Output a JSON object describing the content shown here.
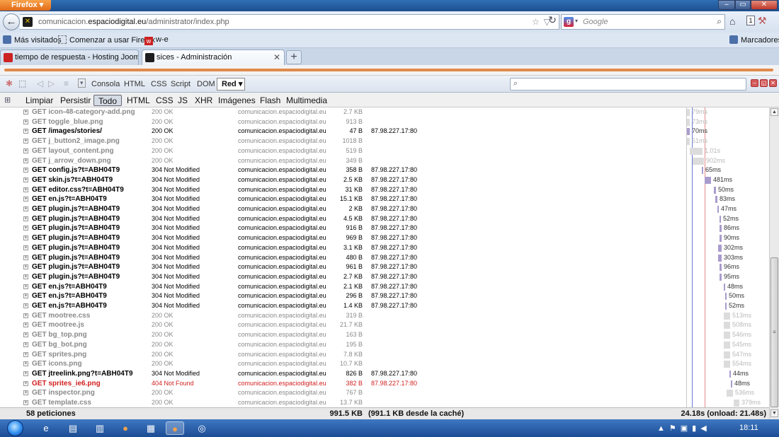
{
  "window": {
    "browser_button": "Firefox",
    "controls": {
      "minimize": "–",
      "maximize": "▭",
      "close": "✕"
    }
  },
  "nav": {
    "url_prefix": "comunicacion.",
    "url_domain": "espaciodigital.eu",
    "url_path": "/administrator/index.php",
    "search_placeholder": "Google"
  },
  "bookmarks": {
    "items": [
      "Más visitados",
      "Comenzar a usar Firefox",
      "w-e"
    ],
    "right": "Marcadores"
  },
  "tabs": [
    {
      "label": "tiempo de respuesta - Hosting Joomla",
      "active": false
    },
    {
      "label": "sices - Administración",
      "active": true
    }
  ],
  "firebug": {
    "panels": [
      "Consola",
      "HTML",
      "CSS",
      "Script",
      "DOM"
    ],
    "active_panel": "Red",
    "filters": [
      "Limpiar",
      "Persistir",
      "Todo",
      "HTML",
      "CSS",
      "JS",
      "XHR",
      "Imágenes",
      "Flash",
      "Multimedia"
    ],
    "active_filter": "Todo"
  },
  "requests": [
    {
      "url": "GET icon-48-category-add.png",
      "status": "200 OK",
      "domain": "comunicacion.espaciodigital.eu",
      "size": "2.7 KB",
      "ip": "",
      "time": "79ms",
      "kind": "cached"
    },
    {
      "url": "GET toggle_blue.png",
      "status": "200 OK",
      "domain": "comunicacion.espaciodigital.eu",
      "size": "913 B",
      "ip": "",
      "time": "73ms",
      "kind": "cached"
    },
    {
      "url": "GET /images/stories/",
      "status": "200 OK",
      "domain": "comunicacion.espaciodigital.eu",
      "size": "47 B",
      "ip": "87.98.227.17:80",
      "time": "70ms",
      "kind": "live"
    },
    {
      "url": "GET j_button2_image.png",
      "status": "200 OK",
      "domain": "comunicacion.espaciodigital.eu",
      "size": "1018 B",
      "ip": "",
      "time": "51ms",
      "kind": "cached"
    },
    {
      "url": "GET layout_content.png",
      "status": "200 OK",
      "domain": "comunicacion.espaciodigital.eu",
      "size": "519 B",
      "ip": "",
      "time": "1.01s",
      "kind": "cached"
    },
    {
      "url": "GET j_arrow_down.png",
      "status": "200 OK",
      "domain": "comunicacion.espaciodigital.eu",
      "size": "349 B",
      "ip": "",
      "time": "902ms",
      "kind": "cached"
    },
    {
      "url": "GET config.js?t=ABH04T9",
      "status": "304 Not Modified",
      "domain": "comunicacion.espaciodigital.eu",
      "size": "358 B",
      "ip": "87.98.227.17:80",
      "time": "65ms",
      "kind": "live"
    },
    {
      "url": "GET skin.js?t=ABH04T9",
      "status": "304 Not Modified",
      "domain": "comunicacion.espaciodigital.eu",
      "size": "2.5 KB",
      "ip": "87.98.227.17:80",
      "time": "481ms",
      "kind": "live"
    },
    {
      "url": "GET editor.css?t=ABH04T9",
      "status": "304 Not Modified",
      "domain": "comunicacion.espaciodigital.eu",
      "size": "31 KB",
      "ip": "87.98.227.17:80",
      "time": "50ms",
      "kind": "live"
    },
    {
      "url": "GET en.js?t=ABH04T9",
      "status": "304 Not Modified",
      "domain": "comunicacion.espaciodigital.eu",
      "size": "15.1 KB",
      "ip": "87.98.227.17:80",
      "time": "83ms",
      "kind": "live"
    },
    {
      "url": "GET plugin.js?t=ABH04T9",
      "status": "304 Not Modified",
      "domain": "comunicacion.espaciodigital.eu",
      "size": "2 KB",
      "ip": "87.98.227.17:80",
      "time": "47ms",
      "kind": "live"
    },
    {
      "url": "GET plugin.js?t=ABH04T9",
      "status": "304 Not Modified",
      "domain": "comunicacion.espaciodigital.eu",
      "size": "4.5 KB",
      "ip": "87.98.227.17:80",
      "time": "52ms",
      "kind": "live"
    },
    {
      "url": "GET plugin.js?t=ABH04T9",
      "status": "304 Not Modified",
      "domain": "comunicacion.espaciodigital.eu",
      "size": "916 B",
      "ip": "87.98.227.17:80",
      "time": "86ms",
      "kind": "live"
    },
    {
      "url": "GET plugin.js?t=ABH04T9",
      "status": "304 Not Modified",
      "domain": "comunicacion.espaciodigital.eu",
      "size": "969 B",
      "ip": "87.98.227.17:80",
      "time": "90ms",
      "kind": "live"
    },
    {
      "url": "GET plugin.js?t=ABH04T9",
      "status": "304 Not Modified",
      "domain": "comunicacion.espaciodigital.eu",
      "size": "3.1 KB",
      "ip": "87.98.227.17:80",
      "time": "302ms",
      "kind": "live"
    },
    {
      "url": "GET plugin.js?t=ABH04T9",
      "status": "304 Not Modified",
      "domain": "comunicacion.espaciodigital.eu",
      "size": "480 B",
      "ip": "87.98.227.17:80",
      "time": "303ms",
      "kind": "live"
    },
    {
      "url": "GET plugin.js?t=ABH04T9",
      "status": "304 Not Modified",
      "domain": "comunicacion.espaciodigital.eu",
      "size": "961 B",
      "ip": "87.98.227.17:80",
      "time": "96ms",
      "kind": "live"
    },
    {
      "url": "GET plugin.js?t=ABH04T9",
      "status": "304 Not Modified",
      "domain": "comunicacion.espaciodigital.eu",
      "size": "2.7 KB",
      "ip": "87.98.227.17:80",
      "time": "95ms",
      "kind": "live"
    },
    {
      "url": "GET en.js?t=ABH04T9",
      "status": "304 Not Modified",
      "domain": "comunicacion.espaciodigital.eu",
      "size": "2.1 KB",
      "ip": "87.98.227.17:80",
      "time": "48ms",
      "kind": "live"
    },
    {
      "url": "GET en.js?t=ABH04T9",
      "status": "304 Not Modified",
      "domain": "comunicacion.espaciodigital.eu",
      "size": "296 B",
      "ip": "87.98.227.17:80",
      "time": "50ms",
      "kind": "live"
    },
    {
      "url": "GET en.js?t=ABH04T9",
      "status": "304 Not Modified",
      "domain": "comunicacion.espaciodigital.eu",
      "size": "1.4 KB",
      "ip": "87.98.227.17:80",
      "time": "52ms",
      "kind": "live"
    },
    {
      "url": "GET mootree.css",
      "status": "200 OK",
      "domain": "comunicacion.espaciodigital.eu",
      "size": "319 B",
      "ip": "",
      "time": "513ms",
      "kind": "cached"
    },
    {
      "url": "GET mootree.js",
      "status": "200 OK",
      "domain": "comunicacion.espaciodigital.eu",
      "size": "21.7 KB",
      "ip": "",
      "time": "508ms",
      "kind": "cached"
    },
    {
      "url": "GET bg_top.png",
      "status": "200 OK",
      "domain": "comunicacion.espaciodigital.eu",
      "size": "163 B",
      "ip": "",
      "time": "546ms",
      "kind": "cached"
    },
    {
      "url": "GET bg_bot.png",
      "status": "200 OK",
      "domain": "comunicacion.espaciodigital.eu",
      "size": "195 B",
      "ip": "",
      "time": "545ms",
      "kind": "cached"
    },
    {
      "url": "GET sprites.png",
      "status": "200 OK",
      "domain": "comunicacion.espaciodigital.eu",
      "size": "7.8 KB",
      "ip": "",
      "time": "547ms",
      "kind": "cached"
    },
    {
      "url": "GET icons.png",
      "status": "200 OK",
      "domain": "comunicacion.espaciodigital.eu",
      "size": "10.7 KB",
      "ip": "",
      "time": "554ms",
      "kind": "cached"
    },
    {
      "url": "GET jtreelink.png?t=ABH04T9",
      "status": "304 Not Modified",
      "domain": "comunicacion.espaciodigital.eu",
      "size": "826 B",
      "ip": "87.98.227.17:80",
      "time": "44ms",
      "kind": "live"
    },
    {
      "url": "GET sprites_ie6.png",
      "status": "404 Not Found",
      "domain": "comunicacion.espaciodigital.eu",
      "size": "382 B",
      "ip": "87.98.227.17:80",
      "time": "48ms",
      "kind": "error"
    },
    {
      "url": "GET inspector.png",
      "status": "200 OK",
      "domain": "comunicacion.espaciodigital.eu",
      "size": "767 B",
      "ip": "",
      "time": "536ms",
      "kind": "cached"
    },
    {
      "url": "GET template.css",
      "status": "200 OK",
      "domain": "comunicacion.espaciodigital.eu",
      "size": "13.7 KB",
      "ip": "",
      "time": "379ms",
      "kind": "cached"
    }
  ],
  "summary": {
    "count": "58 peticiones",
    "total_size": "991.5 KB",
    "cache_note": "(991.1 KB desde la caché)",
    "time": "24.18s (onload: 21.48s)"
  },
  "taskbar": {
    "clock": "18:11"
  }
}
